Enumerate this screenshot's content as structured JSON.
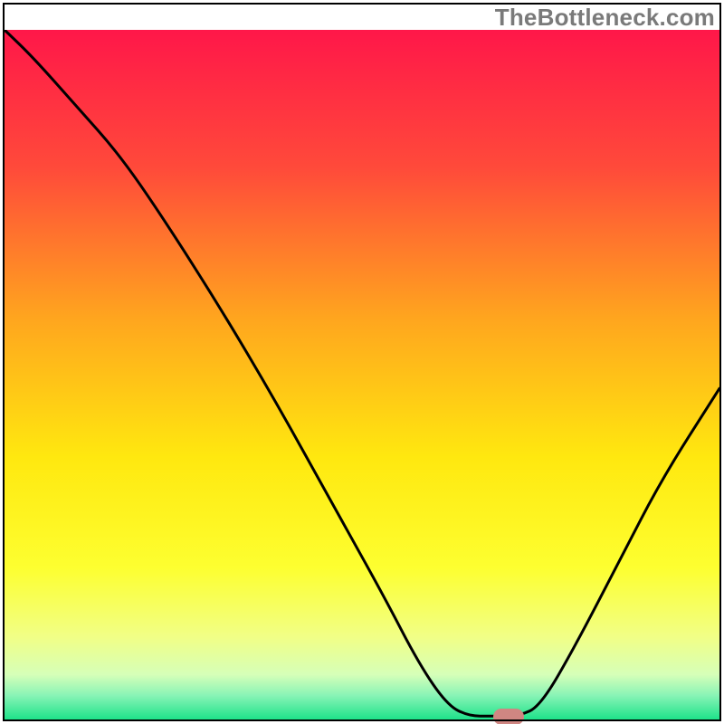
{
  "watermark": "TheBottleneck.com",
  "chart_data": {
    "type": "line",
    "title": "",
    "xlabel": "",
    "ylabel": "",
    "x_range": [
      0,
      100
    ],
    "y_range": [
      0,
      100
    ],
    "gradient_stops": [
      {
        "offset": 0.0,
        "color": "#ff1749"
      },
      {
        "offset": 0.2,
        "color": "#ff4a3a"
      },
      {
        "offset": 0.42,
        "color": "#ffa61e"
      },
      {
        "offset": 0.62,
        "color": "#ffe80f"
      },
      {
        "offset": 0.78,
        "color": "#fdff30"
      },
      {
        "offset": 0.88,
        "color": "#f1ff86"
      },
      {
        "offset": 0.935,
        "color": "#d6ffb8"
      },
      {
        "offset": 0.965,
        "color": "#89f4b6"
      },
      {
        "offset": 1.0,
        "color": "#1ee28a"
      }
    ],
    "curve": [
      {
        "x": 0,
        "y": 100
      },
      {
        "x": 4,
        "y": 96
      },
      {
        "x": 10,
        "y": 89
      },
      {
        "x": 16,
        "y": 82
      },
      {
        "x": 22,
        "y": 73
      },
      {
        "x": 30,
        "y": 60
      },
      {
        "x": 38,
        "y": 46
      },
      {
        "x": 46,
        "y": 31
      },
      {
        "x": 53,
        "y": 18
      },
      {
        "x": 58,
        "y": 8
      },
      {
        "x": 62,
        "y": 2
      },
      {
        "x": 65,
        "y": 0.5
      },
      {
        "x": 68,
        "y": 0.5
      },
      {
        "x": 72,
        "y": 0.5
      },
      {
        "x": 75,
        "y": 2
      },
      {
        "x": 80,
        "y": 11
      },
      {
        "x": 86,
        "y": 23
      },
      {
        "x": 92,
        "y": 35
      },
      {
        "x": 100,
        "y": 48
      }
    ],
    "marker": {
      "x": 70.5,
      "y": 0.4
    },
    "marker_color": "#cf8682"
  }
}
